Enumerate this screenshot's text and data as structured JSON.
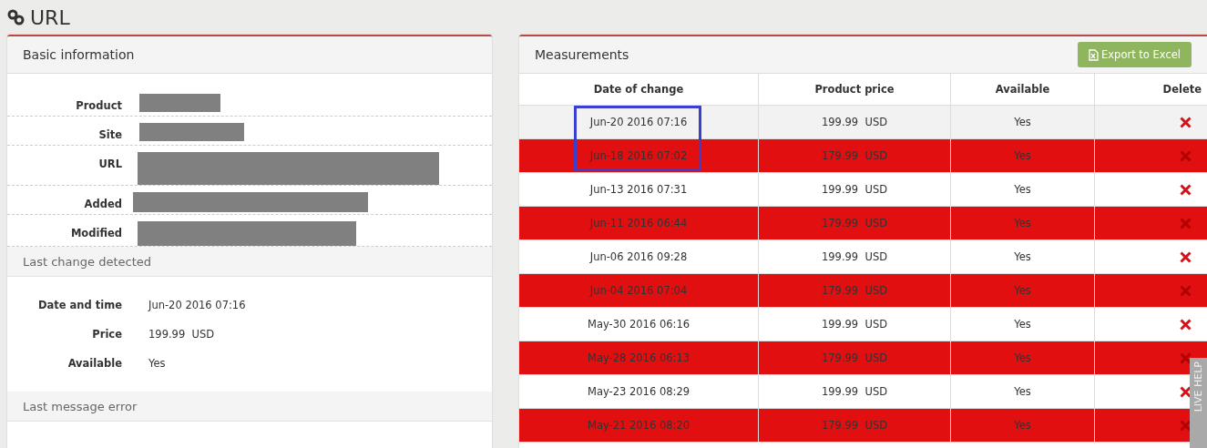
{
  "page": {
    "title": "URL"
  },
  "basic_information": {
    "title": "Basic information",
    "fields": [
      {
        "label": "Product",
        "kind": "redacted"
      },
      {
        "label": "Site",
        "kind": "redacted"
      },
      {
        "label": "URL",
        "kind": "redacted"
      },
      {
        "label": "Added",
        "kind": "redacted"
      },
      {
        "label": "Modified",
        "kind": "redacted"
      }
    ]
  },
  "last_change": {
    "title": "Last change detected",
    "fields": [
      {
        "label": "Date and time",
        "value": "Jun-20 2016 07:16"
      },
      {
        "label": "Price",
        "value": "199.99  USD"
      },
      {
        "label": "Available",
        "value": "Yes"
      }
    ]
  },
  "last_error": {
    "title": "Last message error"
  },
  "measurements": {
    "title": "Measurements",
    "export_button": "Export to Excel",
    "columns": [
      "Date of change",
      "Product price",
      "Available",
      "Delete"
    ],
    "rows": [
      {
        "date": "Jun-20 2016 07:16",
        "price": "199.99  USD",
        "available": "Yes",
        "changed": false,
        "hovered": true
      },
      {
        "date": "Jun-18 2016 07:02",
        "price": "179.99  USD",
        "available": "Yes",
        "changed": true,
        "hovered": false
      },
      {
        "date": "Jun-13 2016 07:31",
        "price": "199.99  USD",
        "available": "Yes",
        "changed": false,
        "hovered": false
      },
      {
        "date": "Jun-11 2016 06:44",
        "price": "179.99  USD",
        "available": "Yes",
        "changed": true,
        "hovered": false
      },
      {
        "date": "Jun-06 2016 09:28",
        "price": "199.99  USD",
        "available": "Yes",
        "changed": false,
        "hovered": false
      },
      {
        "date": "Jun-04 2016 07:04",
        "price": "179.99  USD",
        "available": "Yes",
        "changed": true,
        "hovered": false
      },
      {
        "date": "May-30 2016 06:16",
        "price": "199.99  USD",
        "available": "Yes",
        "changed": false,
        "hovered": false
      },
      {
        "date": "May-28 2016 06:13",
        "price": "179.99  USD",
        "available": "Yes",
        "changed": true,
        "hovered": false
      },
      {
        "date": "May-23 2016 08:29",
        "price": "199.99  USD",
        "available": "Yes",
        "changed": false,
        "hovered": false
      },
      {
        "date": "May-21 2016 08:20",
        "price": "179.99  USD",
        "available": "Yes",
        "changed": true,
        "hovered": false
      }
    ]
  },
  "live_help": {
    "label": "LIVE HELP"
  }
}
